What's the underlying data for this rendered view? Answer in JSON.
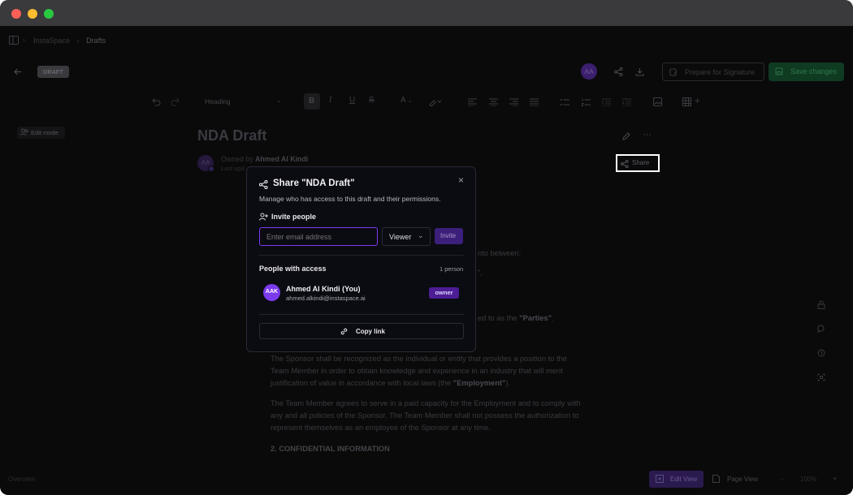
{
  "breadcrumb": {
    "root": "InstaSpace",
    "current": "Drafts"
  },
  "header": {
    "status_badge": "DRAFT",
    "avatar_initials": "AA",
    "prepare_label": "Prepare for Signature",
    "save_label": "Save changes"
  },
  "toolbar": {
    "style_select": "Heading"
  },
  "sidebar": {
    "edit_mode_label": "Edit mode"
  },
  "document": {
    "title": "NDA Draft",
    "owner_prefix": "Owned by",
    "owner_name": "Ahmed Al Kindi",
    "last_updated_fragment": "Last upd",
    "avatar_initials": "AA",
    "share_label": "Share",
    "frag_into_between": "nto between:",
    "frag_quote": "\",",
    "frag_parties_prefix": "ed to as the ",
    "frag_parties": "\"Parties\"",
    "frag_parties_suffix": ".",
    "para1": [
      "The Sponsor shall be recognized as the individual or entity that provides a position to the",
      "Team Member in order to obtain knowledge and experience in an industry that will merit",
      "justification of value in accordance with local laws (the "
    ],
    "para1_bold": "\"Employment\"",
    "para1_end": ").",
    "para2": [
      "The Team Member agrees to serve in a paid capacity for the Employment and to comply with",
      "any and all policies of the Sponsor. The Team Member shall not possess the authorization to",
      "represent themselves as an employee of the Sponsor at any time."
    ],
    "section_heading": "2. CONFIDENTIAL INFORMATION"
  },
  "footer": {
    "left_label": "Overview",
    "edit_view_label": "Edit View",
    "page_view_label": "Page View",
    "zoom": "100%"
  },
  "share_modal": {
    "title": "Share \"NDA Draft\"",
    "subtitle": "Manage who has access to this draft and their permissions.",
    "invite_heading": "Invite people",
    "email_placeholder": "Enter email address",
    "role_value": "Viewer",
    "invite_button": "Invite",
    "people_heading": "People with access",
    "people_count": "1 person",
    "person": {
      "initials": "AAK",
      "name": "Ahmed Al Kindi (You)",
      "email": "ahmed.alkindi@instaspace.ai",
      "role": "owner"
    },
    "copy_link_label": "Copy link"
  },
  "colors": {
    "accent_purple": "#6d28d9",
    "save_green": "#14532d",
    "modal_bg": "#0b0b12",
    "focus_ring": "#7c3aed"
  }
}
